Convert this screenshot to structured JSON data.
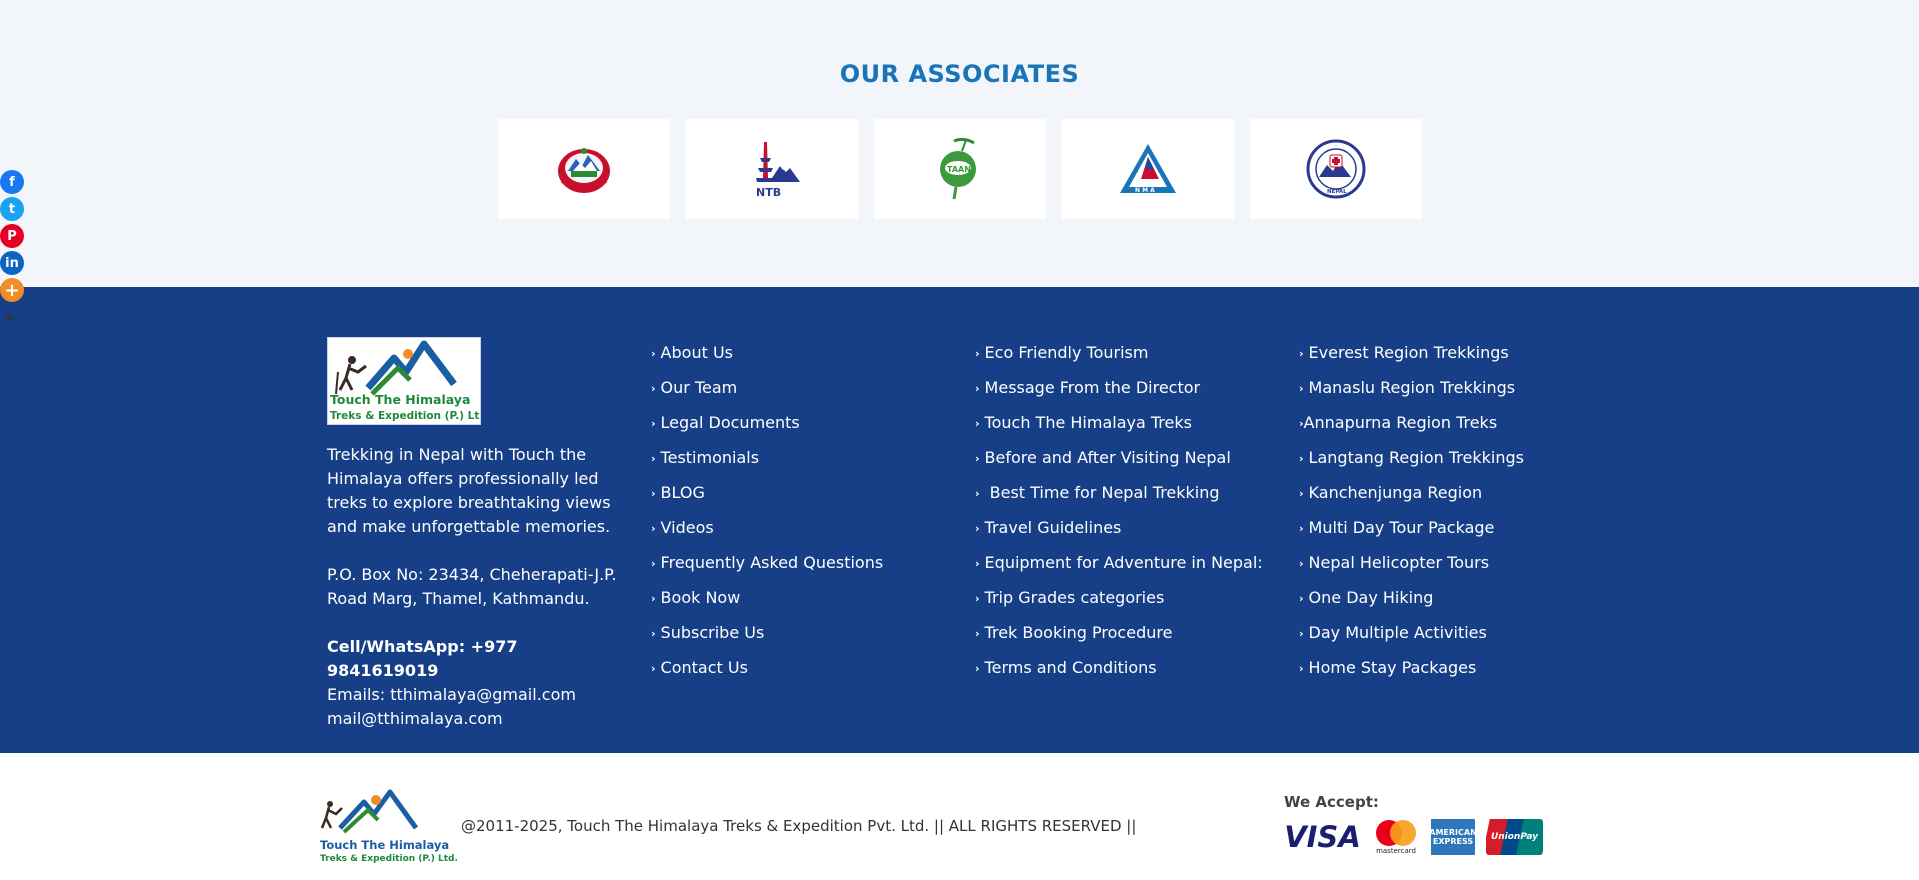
{
  "share": {
    "items": [
      {
        "label": "f",
        "icon": "facebook-icon",
        "color": "#1877f2"
      },
      {
        "label": "t",
        "icon": "twitter-icon",
        "color": "#1da1f2"
      },
      {
        "label": "P",
        "icon": "pinterest-icon",
        "color": "#e60023"
      },
      {
        "label": "in",
        "icon": "linkedin-icon",
        "color": "#0a66c2"
      },
      {
        "label": "+",
        "icon": "more-icon",
        "color": "#f28c28"
      }
    ],
    "hide_icon": "hide-icon"
  },
  "associates": {
    "title": "OUR ASSOCIATES",
    "items": [
      {
        "name": "Government of Nepal emblem",
        "icon": "nepal-emblem-icon"
      },
      {
        "name": "NTB",
        "label": "NTB",
        "icon": "ntb-logo-icon"
      },
      {
        "name": "TAAN",
        "label": "TAAN",
        "icon": "taan-logo-icon"
      },
      {
        "name": "NMA",
        "label": "N M A",
        "icon": "nma-logo-icon"
      },
      {
        "name": "Himalayan Rescue Association Nepal",
        "label": "NEPAL",
        "icon": "hra-logo-icon"
      }
    ]
  },
  "brand": {
    "logo_line1": "Touch The Himalaya",
    "logo_line2": "Treks & Expedition (P.) Ltd.",
    "description": "Trekking in Nepal with Touch the Himalaya offers professionally led treks to explore breathtaking views and make unforgettable memories.",
    "address": " P.O. Box No: 23434, Cheherapati-J.P. Road Marg, Thamel, Kathmandu.",
    "phone": "Cell/WhatsApp: +977 9841619019",
    "email_line1": "Emails: tthimalaya@gmail.com",
    "email_line2": "mail@tthimalaya.com"
  },
  "links": {
    "col1": [
      "About Us",
      "Our Team",
      "Legal Documents",
      "Testimonials",
      "BLOG",
      "Videos",
      "Frequently Asked Questions",
      "Book Now",
      "Subscribe Us",
      "Contact Us"
    ],
    "col2": [
      "Eco Friendly Tourism",
      "Message From the Director",
      "Touch The Himalaya Treks",
      "Before and After Visiting Nepal",
      " Best Time for Nepal Trekking",
      "Travel Guidelines",
      "Equipment for Adventure in Nepal:",
      "Trip Grades categories",
      "Trek Booking Procedure",
      "Terms and Conditions"
    ],
    "col3": [
      "Everest Region Trekkings",
      "Manaslu Region Trekkings",
      "Annapurna Region Treks",
      "Langtang Region Trekkings",
      "Kanchenjunga Region",
      "Multi Day Tour Package",
      "Nepal Helicopter Tours",
      "One Day Hiking",
      "Day Multiple Activities",
      "Home Stay Packages"
    ],
    "chevron": "›"
  },
  "bottom": {
    "logo_line1": "Touch The Himalaya",
    "logo_line2": "Treks & Expedition (P.) Ltd.",
    "copyright": "@2011-2025, Touch The Himalaya Treks & Expedition Pvt. Ltd. || ALL RIGHTS RESERVED ||",
    "we_accept": "We Accept:",
    "cards": {
      "visa": "VISA",
      "mastercard": "mastercard",
      "amex": "AMERICAN EXPRESS",
      "unionpay": "UnionPay"
    }
  },
  "colors": {
    "accent": "#1a74b8",
    "footer_bg": "#173f87",
    "page_bg": "#f2f6fa"
  }
}
